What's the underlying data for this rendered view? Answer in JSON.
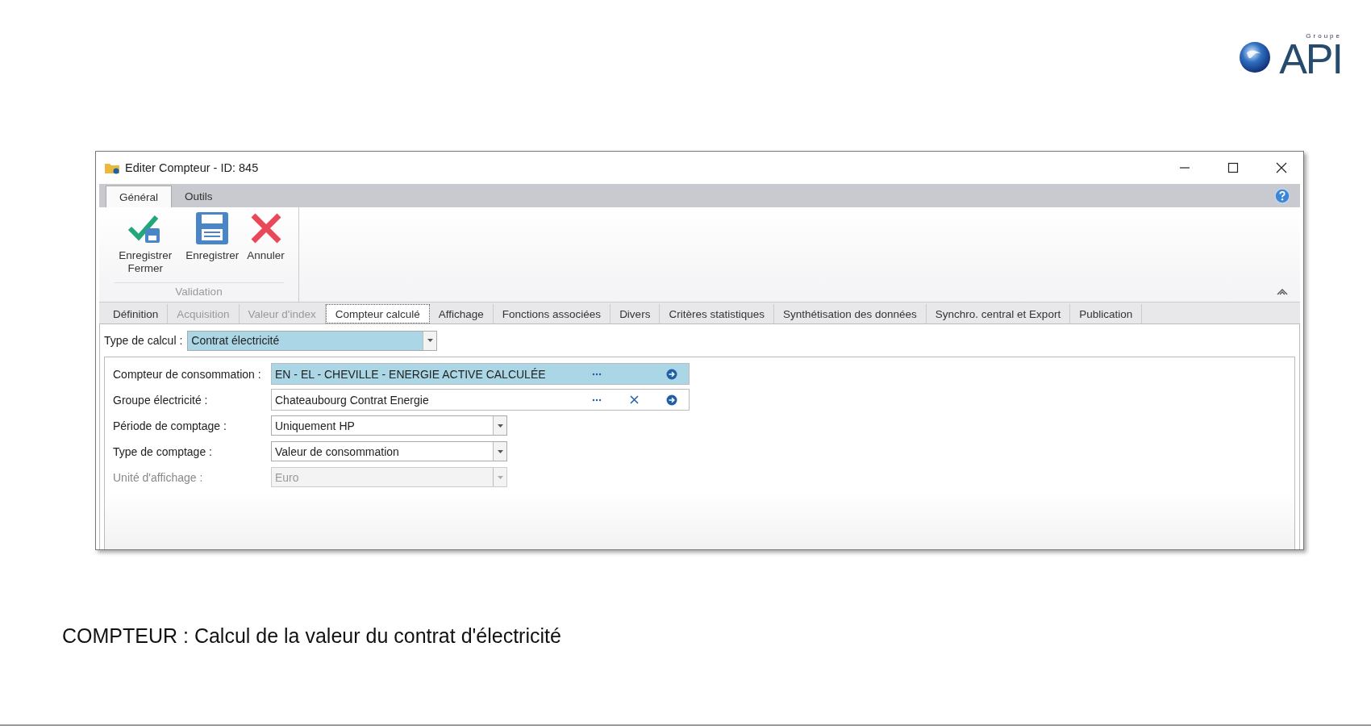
{
  "logo": {
    "small_text": "Groupe",
    "text": "API"
  },
  "window": {
    "title": "Editer Compteur - ID: 845"
  },
  "ribbon": {
    "tabs": [
      {
        "label": "Général",
        "selected": true
      },
      {
        "label": "Outils",
        "selected": false
      }
    ],
    "buttons": [
      {
        "kind": "save-close",
        "label": "Enregistrer Fermer"
      },
      {
        "kind": "save",
        "label": "Enregistrer"
      },
      {
        "kind": "cancel",
        "label": "Annuler"
      }
    ],
    "group_label": "Validation"
  },
  "tabs": [
    {
      "label": "Définition",
      "selected": false,
      "disabled": false
    },
    {
      "label": "Acquisition",
      "selected": false,
      "disabled": true
    },
    {
      "label": "Valeur d'index",
      "selected": false,
      "disabled": true
    },
    {
      "label": "Compteur calculé",
      "selected": true,
      "disabled": false
    },
    {
      "label": "Affichage",
      "selected": false,
      "disabled": false
    },
    {
      "label": "Fonctions associées",
      "selected": false,
      "disabled": false
    },
    {
      "label": "Divers",
      "selected": false,
      "disabled": false
    },
    {
      "label": "Critères statistiques",
      "selected": false,
      "disabled": false
    },
    {
      "label": "Synthétisation des données",
      "selected": false,
      "disabled": false
    },
    {
      "label": "Synchro. central et Export",
      "selected": false,
      "disabled": false
    },
    {
      "label": "Publication",
      "selected": false,
      "disabled": false
    }
  ],
  "calc_type": {
    "label": "Type de calcul :",
    "value": "Contrat électricité",
    "highlighted": true
  },
  "fields": [
    {
      "kind": "picker",
      "label": "Compteur de consommation :",
      "value": "EN - EL - CHEVILLE - ENERGIE ACTIVE CALCULÉE",
      "highlighted": true,
      "clearable": false,
      "disabled": false
    },
    {
      "kind": "picker",
      "label": "Groupe électricité :",
      "value": "Chateaubourg Contrat Energie",
      "highlighted": false,
      "clearable": true,
      "disabled": false
    },
    {
      "kind": "dropdown",
      "label": "Période de comptage :",
      "value": "Uniquement HP",
      "highlighted": false,
      "disabled": false
    },
    {
      "kind": "dropdown",
      "label": "Type de comptage :",
      "value": "Valeur de consommation",
      "highlighted": false,
      "disabled": false
    },
    {
      "kind": "dropdown",
      "label": "Unité d'affichage :",
      "value": "Euro",
      "highlighted": false,
      "disabled": true
    }
  ],
  "caption": "COMPTEUR : Calcul de la valeur du contrat d'électricité"
}
